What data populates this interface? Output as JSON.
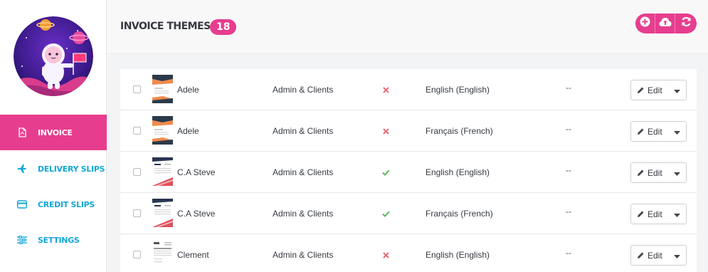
{
  "header": {
    "title": "INVOICE THEMES",
    "count": "18",
    "buttons": [
      {
        "icon": "plus-circle-icon"
      },
      {
        "icon": "cloud-upload-icon"
      },
      {
        "icon": "refresh-icon"
      }
    ]
  },
  "sidebar": {
    "items": [
      {
        "label": "INVOICE",
        "icon": "pdf-file-icon",
        "active": true
      },
      {
        "label": "DELIVERY SLIPS",
        "icon": "plane-icon",
        "active": false
      },
      {
        "label": "CREDIT SLIPS",
        "icon": "credit-card-icon",
        "active": false
      },
      {
        "label": "SETTINGS",
        "icon": "sliders-icon",
        "active": false
      }
    ]
  },
  "table": {
    "rows": [
      {
        "name": "Adele",
        "access": "Admin & Clients",
        "status": "disabled",
        "language": "English (English)",
        "extra": "--",
        "edit_label": "Edit"
      },
      {
        "name": "Adele",
        "access": "Admin & Clients",
        "status": "disabled",
        "language": "Français (French)",
        "extra": "--",
        "edit_label": "Edit"
      },
      {
        "name": "C.A Steve",
        "access": "Admin & Clients",
        "status": "enabled",
        "language": "English (English)",
        "extra": "--",
        "edit_label": "Edit"
      },
      {
        "name": "C.A Steve",
        "access": "Admin & Clients",
        "status": "enabled",
        "language": "Français (French)",
        "extra": "--",
        "edit_label": "Edit"
      },
      {
        "name": "Clement",
        "access": "Admin & Clients",
        "status": "disabled",
        "language": "English (English)",
        "extra": "--",
        "edit_label": "Edit"
      }
    ]
  },
  "colors": {
    "accent": "#e73d8e",
    "nav_text": "#12a7d8",
    "status_enabled": "#5cb85c",
    "status_disabled": "#e46a76"
  }
}
